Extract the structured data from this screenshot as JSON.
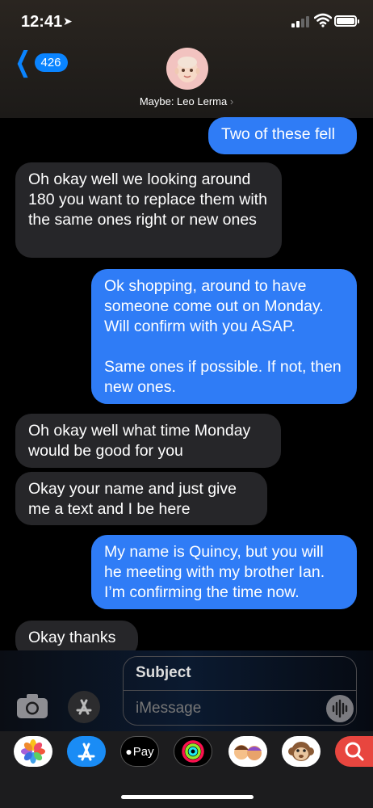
{
  "status": {
    "time": "12:41"
  },
  "nav": {
    "back_count": "426",
    "contact_label": "Maybe: Leo Lerma"
  },
  "messages": [
    {
      "from": "me",
      "text": "Two of these fell"
    },
    {
      "from": "them",
      "text": "Oh okay well we looking around 180 you want to replace them with the same ones right or new ones"
    },
    {
      "from": "me",
      "text": "Ok shopping, around to have someone come out on Monday. Will confirm with you ASAP.\n\nSame ones if possible. If not, then new ones."
    },
    {
      "from": "them",
      "text": "Oh okay well what time Monday would be good for you"
    },
    {
      "from": "them",
      "text": "Okay your name and just give me a text and I be here"
    },
    {
      "from": "me",
      "text": "My name is Quincy, but you will he meeting with my brother Ian. I’m confirming the time now."
    },
    {
      "from": "them",
      "text": "Okay thanks"
    }
  ],
  "compose": {
    "subject_placeholder": "Subject",
    "message_placeholder": "iMessage"
  },
  "apps": [
    {
      "name": "photos-icon"
    },
    {
      "name": "app-store-icon"
    },
    {
      "name": "apple-pay-icon",
      "label": "Pay"
    },
    {
      "name": "activity-icon"
    },
    {
      "name": "memoji-icon"
    },
    {
      "name": "animoji-icon"
    },
    {
      "name": "web-search-icon"
    }
  ],
  "colors": {
    "outgoing": "#2f7cf6",
    "incoming": "#262629",
    "accent": "#0a84ff"
  }
}
